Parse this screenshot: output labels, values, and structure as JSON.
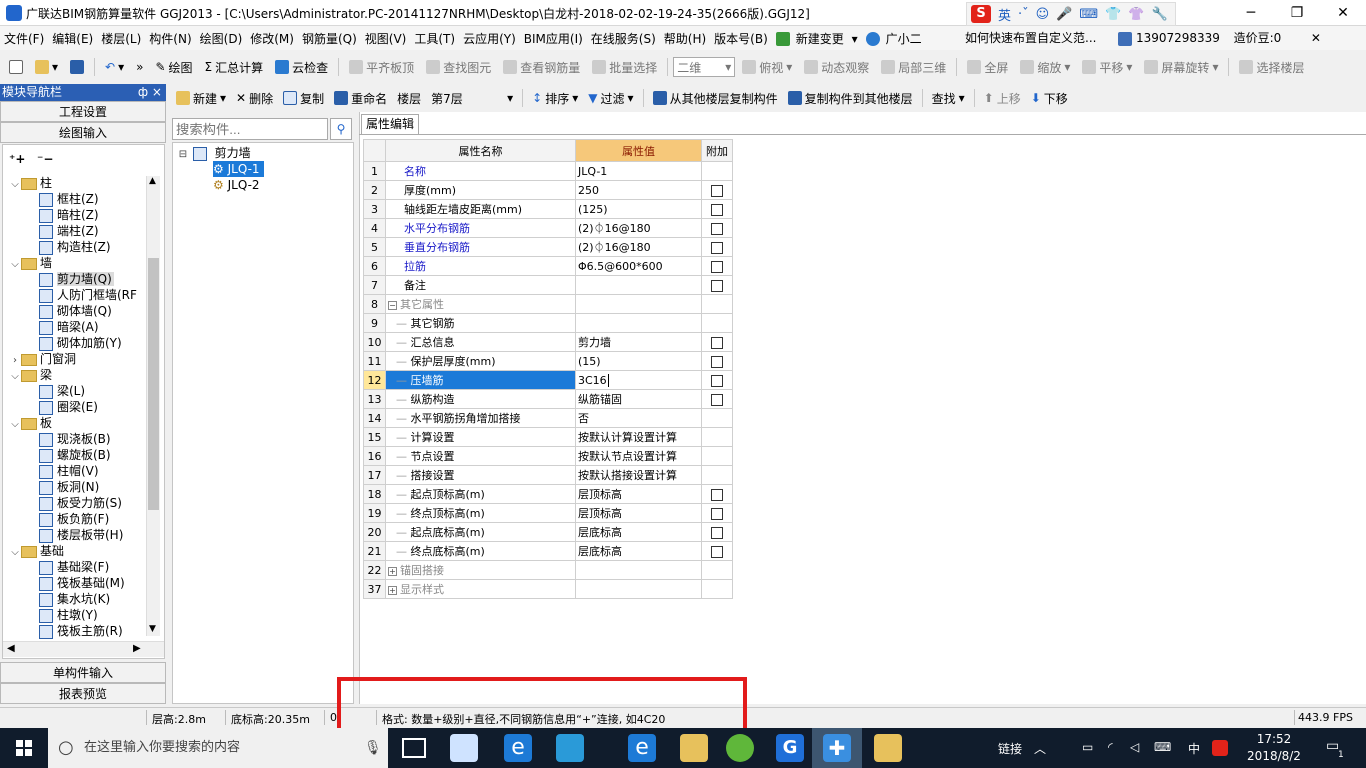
{
  "window": {
    "title": "广联达BIM钢筋算量软件 GGJ2013 - [C:\\Users\\Administrator.PC-20141127NRHM\\Desktop\\白龙村-2018-02-02-19-24-35(2666版).GGJ12]",
    "minimize": "─",
    "maximize": "❐",
    "close": "✕"
  },
  "ime": {
    "logo": "S",
    "lang": "英",
    "icons": [
      "·ˇ",
      "☺",
      "🎤",
      "⌨",
      "👕",
      "👚",
      "🔧"
    ]
  },
  "menubar": {
    "items": [
      "文件(F)",
      "编辑(E)",
      "楼层(L)",
      "构件(N)",
      "绘图(D)",
      "修改(M)",
      "钢筋量(Q)",
      "视图(V)",
      "工具(T)",
      "云应用(Y)",
      "BIM应用(I)",
      "在线服务(S)",
      "帮助(H)",
      "版本号(B)",
      "新建变更",
      "广小二"
    ],
    "help_tip": "如何快速布置自定义范...",
    "phone": "13907298339",
    "beans": "造价豆:0"
  },
  "toolbar1": {
    "draw": "绘图",
    "sum": "汇总计算",
    "cloud_check": "云检查",
    "flat_board": "平齐板顶",
    "find_elem": "查找图元",
    "view_steel": "查看钢筋量",
    "batch_select": "批量选择",
    "view_mode": "二维",
    "top_view": "俯视",
    "dynamic": "动态观察",
    "local3d": "局部三维",
    "fullscreen": "全屏",
    "zoom": "缩放",
    "pan": "平移",
    "rotate": "屏幕旋转",
    "select_floor": "选择楼层"
  },
  "nav": {
    "title": "模块导航栏",
    "pin": "ф ×",
    "project_settings": "工程设置",
    "drawing_input": "绘图输入",
    "single_input": "单构件输入",
    "report_preview": "报表预览"
  },
  "tree": [
    {
      "type": "group",
      "label": "柱",
      "expanded": true
    },
    {
      "type": "item",
      "label": "框柱(Z)"
    },
    {
      "type": "item",
      "label": "暗柱(Z)"
    },
    {
      "type": "item",
      "label": "端柱(Z)"
    },
    {
      "type": "item",
      "label": "构造柱(Z)"
    },
    {
      "type": "group",
      "label": "墙",
      "expanded": true
    },
    {
      "type": "item",
      "label": "剪力墙(Q)",
      "selected": true
    },
    {
      "type": "item",
      "label": "人防门框墙(RF"
    },
    {
      "type": "item",
      "label": "砌体墙(Q)"
    },
    {
      "type": "item",
      "label": "暗梁(A)"
    },
    {
      "type": "item",
      "label": "砌体加筋(Y)"
    },
    {
      "type": "group",
      "label": "门窗洞",
      "expanded": false
    },
    {
      "type": "group",
      "label": "梁",
      "expanded": true
    },
    {
      "type": "item",
      "label": "梁(L)"
    },
    {
      "type": "item",
      "label": "圈梁(E)"
    },
    {
      "type": "group",
      "label": "板",
      "expanded": true
    },
    {
      "type": "item",
      "label": "现浇板(B)"
    },
    {
      "type": "item",
      "label": "螺旋板(B)"
    },
    {
      "type": "item",
      "label": "柱帽(V)"
    },
    {
      "type": "item",
      "label": "板洞(N)"
    },
    {
      "type": "item",
      "label": "板受力筋(S)"
    },
    {
      "type": "item",
      "label": "板负筋(F)"
    },
    {
      "type": "item",
      "label": "楼层板带(H)"
    },
    {
      "type": "group",
      "label": "基础",
      "expanded": true
    },
    {
      "type": "item",
      "label": "基础梁(F)"
    },
    {
      "type": "item",
      "label": "筏板基础(M)"
    },
    {
      "type": "item",
      "label": "集水坑(K)"
    },
    {
      "type": "item",
      "label": "柱墩(Y)"
    },
    {
      "type": "item",
      "label": "筏板主筋(R)"
    }
  ],
  "toolbar2": {
    "new": "新建",
    "delete": "删除",
    "copy": "复制",
    "rename": "重命名",
    "floor_label": "楼层",
    "floor_value": "第7层",
    "sort": "排序",
    "filter": "过滤",
    "copy_from": "从其他楼层复制构件",
    "copy_to": "复制构件到其他楼层",
    "find": "查找",
    "move_up": "上移",
    "move_down": "下移"
  },
  "component": {
    "search_placeholder": "搜索构件...",
    "root": "剪力墙",
    "items": [
      "JLQ-1",
      "JLQ-2"
    ]
  },
  "props": {
    "tab": "属性编辑",
    "col_name": "属性名称",
    "col_value": "属性值",
    "col_extra": "附加",
    "rows": [
      {
        "num": "1",
        "name": "名称",
        "value": "JLQ-1",
        "blue": true,
        "check": false,
        "indent": 0
      },
      {
        "num": "2",
        "name": "厚度(mm)",
        "value": "250",
        "check": true,
        "indent": 0
      },
      {
        "num": "3",
        "name": "轴线距左墙皮距离(mm)",
        "value": "(125)",
        "check": true,
        "indent": 0
      },
      {
        "num": "4",
        "name": "水平分布钢筋",
        "value": "(2)⏀16@180",
        "blue": true,
        "check": true,
        "indent": 0
      },
      {
        "num": "5",
        "name": "垂直分布钢筋",
        "value": "(2)⏀16@180",
        "blue": true,
        "check": true,
        "indent": 0
      },
      {
        "num": "6",
        "name": "拉筋",
        "value": "Φ6.5@600*600",
        "blue": true,
        "check": true,
        "indent": 0
      },
      {
        "num": "7",
        "name": "备注",
        "value": "",
        "check": true,
        "indent": 0
      },
      {
        "num": "8",
        "name": "其它属性",
        "value": "",
        "gray": true,
        "toggle": "−",
        "check": false,
        "indent": 0
      },
      {
        "num": "9",
        "name": "其它钢筋",
        "value": "",
        "check": false,
        "indent": 1
      },
      {
        "num": "10",
        "name": "汇总信息",
        "value": "剪力墙",
        "check": true,
        "indent": 1
      },
      {
        "num": "11",
        "name": "保护层厚度(mm)",
        "value": "(15)",
        "check": true,
        "indent": 1
      },
      {
        "num": "12",
        "name": "压墙筋",
        "value": "3C16",
        "selected": true,
        "check": true,
        "indent": 1
      },
      {
        "num": "13",
        "name": "纵筋构造",
        "value": "纵筋锚固",
        "check": true,
        "indent": 1
      },
      {
        "num": "14",
        "name": "水平钢筋拐角增加搭接",
        "value": "否",
        "check": false,
        "indent": 1
      },
      {
        "num": "15",
        "name": "计算设置",
        "value": "按默认计算设置计算",
        "check": false,
        "indent": 1
      },
      {
        "num": "16",
        "name": "节点设置",
        "value": "按默认节点设置计算",
        "check": false,
        "indent": 1
      },
      {
        "num": "17",
        "name": "搭接设置",
        "value": "按默认搭接设置计算",
        "check": false,
        "indent": 1
      },
      {
        "num": "18",
        "name": "起点顶标高(m)",
        "value": "层顶标高",
        "check": true,
        "indent": 1
      },
      {
        "num": "19",
        "name": "终点顶标高(m)",
        "value": "层顶标高",
        "check": true,
        "indent": 1
      },
      {
        "num": "20",
        "name": "起点底标高(m)",
        "value": "层底标高",
        "check": true,
        "indent": 1
      },
      {
        "num": "21",
        "name": "终点底标高(m)",
        "value": "层底标高",
        "check": true,
        "indent": 1
      },
      {
        "num": "22",
        "name": "锚固搭接",
        "value": "",
        "gray": true,
        "toggle": "+",
        "check": false,
        "indent": 0
      },
      {
        "num": "37",
        "name": "显示样式",
        "value": "",
        "gray": true,
        "toggle": "+",
        "check": false,
        "indent": 0
      }
    ]
  },
  "status": {
    "floor_height": "层高:2.8m",
    "base_elev": "底标高:20.35m",
    "zero": "0",
    "hint": "格式: 数量+级别+直径,不同钢筋信息用“+”连接, 如4C20",
    "fps": "443.9 FPS"
  },
  "taskbar": {
    "search": "在这里输入你要搜索的内容",
    "links": "链接",
    "input_lang": "中",
    "time": "17:52",
    "date": "2018/8/2",
    "notify_count": "1"
  },
  "colors": {
    "nav_blue": "#2b5fb4",
    "select_blue": "#1c7ad8",
    "header_orange": "#f6c87a",
    "highlight_red": "#e21b1b",
    "taskbar": "#101c2c"
  }
}
